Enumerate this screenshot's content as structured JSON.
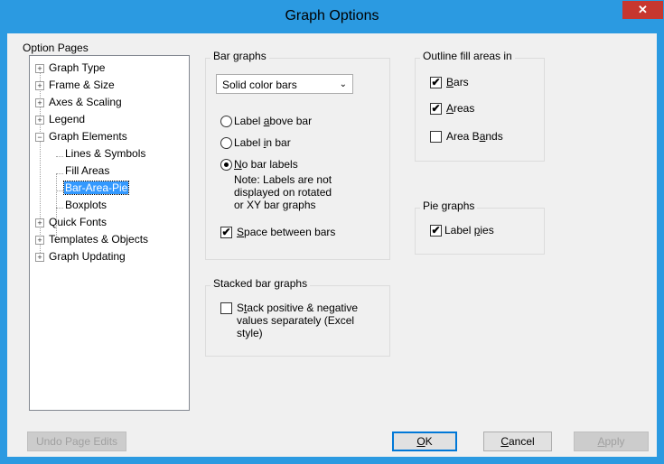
{
  "window": {
    "title": "Graph Options",
    "close_glyph": "✕"
  },
  "option_pages": {
    "label": "Option Pages",
    "items": [
      {
        "label": "Graph Type",
        "expander": "+"
      },
      {
        "label": "Frame & Size",
        "expander": "+"
      },
      {
        "label": "Axes & Scaling",
        "expander": "+"
      },
      {
        "label": "Legend",
        "expander": "+"
      },
      {
        "label": "Graph Elements",
        "expander": "−"
      },
      {
        "label": "Lines & Symbols"
      },
      {
        "label": "Fill Areas"
      },
      {
        "label": "Bar-Area-Pie",
        "selected": true
      },
      {
        "label": "Boxplots"
      },
      {
        "label": "Quick Fonts",
        "expander": "+"
      },
      {
        "label": "Templates & Objects",
        "expander": "+"
      },
      {
        "label": "Graph Updating",
        "expander": "+"
      }
    ]
  },
  "bar_graphs": {
    "label": "Bar graphs",
    "fill_select": "Solid color bars",
    "radio_above": {
      "pre": "Label ",
      "key": "a",
      "post": "bove bar",
      "checked": false
    },
    "radio_in": {
      "pre": "Label ",
      "key": "i",
      "post": "n bar",
      "checked": false
    },
    "radio_none": {
      "pre": "",
      "key": "N",
      "post": "o bar labels",
      "checked": true
    },
    "note_1": "Note: Labels are not",
    "note_2": "displayed on rotated",
    "note_3": "or XY bar graphs",
    "space_between": {
      "pre": "",
      "key": "S",
      "post": "pace between bars",
      "checked": true
    }
  },
  "stacked": {
    "label": "Stacked bar graphs",
    "stack_sep": {
      "pre": "S",
      "key": "t",
      "post": "ack positive & negative",
      "checked": false
    },
    "line2": "values separately (Excel",
    "line3": "style)"
  },
  "outline": {
    "label": "Outline fill areas in",
    "bars": {
      "pre": "",
      "key": "B",
      "post": "ars",
      "checked": true
    },
    "areas": {
      "pre": "",
      "key": "A",
      "post": "reas",
      "checked": true
    },
    "bands": {
      "pre": "Area B",
      "key": "a",
      "post": "nds",
      "checked": false
    }
  },
  "pie": {
    "label": "Pie graphs",
    "label_pies": {
      "pre": "Label ",
      "key": "p",
      "post": "ies",
      "checked": true
    }
  },
  "buttons": {
    "undo": "Undo Page Edits",
    "ok": {
      "pre": "",
      "key": "O",
      "post": "K"
    },
    "cancel": {
      "pre": "",
      "key": "C",
      "post": "ancel"
    },
    "apply": {
      "pre": "",
      "key": "A",
      "post": "pply"
    }
  },
  "glyphs": {
    "check": "✔",
    "dropdown_arrow": "⌄"
  }
}
